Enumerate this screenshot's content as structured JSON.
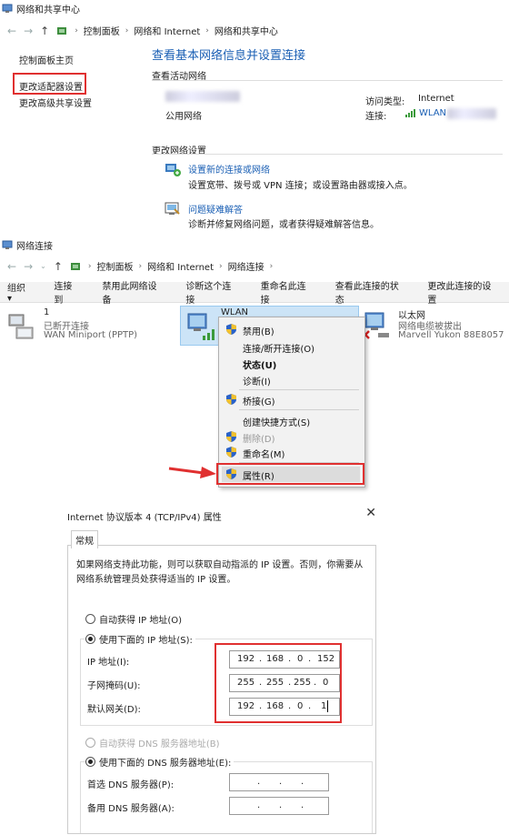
{
  "win1": {
    "title": "网络和共享中心",
    "breadcrumb": [
      "控制面板",
      "网络和 Internet",
      "网络和共享中心"
    ],
    "sidebar": [
      "控制面板主页",
      "更改适配器设置",
      "更改高级共享设置"
    ],
    "heading": "查看基本网络信息并设置连接",
    "active_net_label": "查看活动网络",
    "net_type": "公用网络",
    "access_type_label": "访问类型:",
    "access_type_value": "Internet",
    "connection_label": "连接:",
    "connection_value": "WLAN",
    "change_settings_label": "更改网络设置",
    "tasks": [
      {
        "title": "设置新的连接或网络",
        "desc": "设置宽带、拨号或 VPN 连接；或设置路由器或接入点。"
      },
      {
        "title": "问题疑难解答",
        "desc": "诊断并修复网络问题，或者获得疑难解答信息。"
      }
    ]
  },
  "win2": {
    "title": "网络连接",
    "breadcrumb": [
      "控制面板",
      "网络和 Internet",
      "网络连接"
    ],
    "toolbar": [
      "组织 ▾",
      "连接到",
      "禁用此网络设备",
      "诊断这个连接",
      "重命名此连接",
      "查看此连接的状态",
      "更改此连接的设置"
    ],
    "adapters": [
      {
        "name": "1",
        "status": "已断开连接",
        "device": "WAN Miniport (PPTP)"
      },
      {
        "name": "WLAN",
        "status": "",
        "device": ""
      },
      {
        "name": "以太网",
        "status": "网络电缆被拔出",
        "device": "Marvell Yukon 88E8057"
      }
    ],
    "context_menu": [
      "禁用(B)",
      "连接/断开连接(O)",
      "状态(U)",
      "诊断(I)",
      "桥接(G)",
      "创建快捷方式(S)",
      "删除(D)",
      "重命名(M)",
      "属性(R)"
    ]
  },
  "dialog": {
    "title": "Internet 协议版本 4 (TCP/IPv4) 属性",
    "tab": "常规",
    "desc": "如果网络支持此功能，则可以获取自动指派的 IP 设置。否则，你需要从网络系统管理员处获得适当的 IP 设置。",
    "auto_ip": "自动获得 IP 地址(O)",
    "manual_ip": "使用下面的 IP 地址(S):",
    "ip_label": "IP 地址(I):",
    "mask_label": "子网掩码(U):",
    "gw_label": "默认网关(D):",
    "ip": [
      "192",
      "168",
      "0",
      "152"
    ],
    "mask": [
      "255",
      "255",
      "255",
      "0"
    ],
    "gateway": [
      "192",
      "168",
      "0",
      "1"
    ],
    "auto_dns": "自动获得 DNS 服务器地址(B)",
    "manual_dns": "使用下面的 DNS 服务器地址(E):",
    "dns1_label": "首选 DNS 服务器(P):",
    "dns2_label": "备用 DNS 服务器(A):"
  }
}
